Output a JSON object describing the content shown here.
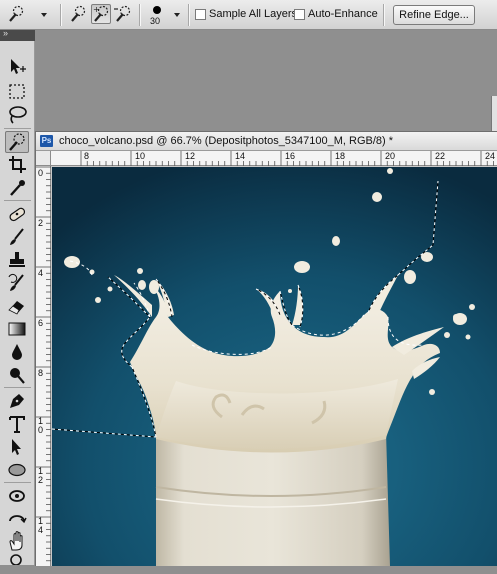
{
  "options_bar": {
    "brush_size": "30",
    "sample_all_layers": {
      "label": "Sample All Layers",
      "checked": false
    },
    "auto_enhance": {
      "label": "Auto-Enhance",
      "checked": false
    },
    "refine_edge_label": "Refine Edge..."
  },
  "tools_panel": {
    "collapse_glyph": "»",
    "tools": [
      {
        "name": "move-tool",
        "icon": "move-icon"
      },
      {
        "name": "marquee-tool",
        "icon": "marquee-icon"
      },
      {
        "name": "lasso-tool",
        "icon": "lasso-icon"
      },
      {
        "name": "quick-selection-tool",
        "icon": "quick-selection-icon",
        "active": true
      },
      {
        "name": "crop-tool",
        "icon": "crop-icon"
      },
      {
        "name": "eyedropper-tool",
        "icon": "eyedropper-icon"
      },
      {
        "name": "healing-brush-tool",
        "icon": "healing-brush-icon"
      },
      {
        "name": "brush-tool",
        "icon": "brush-icon"
      },
      {
        "name": "clone-stamp-tool",
        "icon": "clone-stamp-icon"
      },
      {
        "name": "history-brush-tool",
        "icon": "history-brush-icon"
      },
      {
        "name": "eraser-tool",
        "icon": "eraser-icon"
      },
      {
        "name": "gradient-tool",
        "icon": "gradient-icon"
      },
      {
        "name": "blur-tool",
        "icon": "blur-icon"
      },
      {
        "name": "dodge-tool",
        "icon": "dodge-icon"
      },
      {
        "name": "pen-tool",
        "icon": "pen-icon"
      },
      {
        "name": "type-tool",
        "icon": "type-icon"
      },
      {
        "name": "path-selection-tool",
        "icon": "path-selection-icon"
      },
      {
        "name": "ellipse-tool",
        "icon": "ellipse-icon"
      },
      {
        "name": "3d-rotate-tool",
        "icon": "3d-rotate-icon"
      },
      {
        "name": "3d-orbit-tool",
        "icon": "3d-orbit-icon"
      },
      {
        "name": "hand-tool",
        "icon": "hand-icon"
      },
      {
        "name": "zoom-tool",
        "icon": "zoom-icon"
      }
    ]
  },
  "document": {
    "badge": "Ps",
    "title": "choco_volcano.psd @ 66.7% (Depositphotos_5347100_M, RGB/8) *",
    "zoom": "66.7%"
  },
  "rulers": {
    "horizontal": [
      "8",
      "10",
      "12",
      "14",
      "16",
      "18",
      "20",
      "22",
      "24"
    ],
    "vertical": [
      "0",
      "2",
      "4",
      "6",
      "8",
      "1\n0",
      "1\n2",
      "1\n4"
    ]
  },
  "colors": {
    "canvas_background_center": "#1d6e8e",
    "canvas_background_edge": "#0a2b3f",
    "milk": "#f1ecdf",
    "milk_shadow": "#c9bca0",
    "glass": "#d8d4c6"
  }
}
